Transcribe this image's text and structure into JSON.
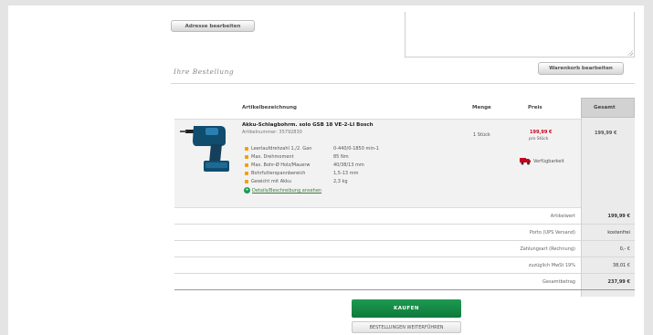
{
  "address": {
    "edit_button": "Adresse bearbeiten"
  },
  "order": {
    "section_title": "Ihre Bestellung",
    "edit_cart_button": "Warenkorb bearbeiten",
    "columns": {
      "name": "Artikelbezeichnung",
      "qty": "Menge",
      "price": "Preis",
      "total": "Gesamt"
    },
    "item": {
      "title": "Akku-Schlagbohrm. solo GSB 18 VE-2-LI Bosch",
      "article_no": "Artikelnummer: 35792830",
      "specs": [
        {
          "label": "Leerlaufdrehzahl 1./2. Gan",
          "value": "0-440/0-1850 min-1"
        },
        {
          "label": "Max. Drehmoment",
          "value": "85 Nm"
        },
        {
          "label": "Max. Bohr-Ø Holz/Mauerw",
          "value": "40/38/13 mm"
        },
        {
          "label": "Bohrfutterspannbereich",
          "value": "1,5-13 mm"
        },
        {
          "label": "Gewicht mit Akku",
          "value": "2,3 kg"
        }
      ],
      "details_link": "Details/Beschreibung ansehen",
      "qty": "1 Stück",
      "price": "199,99 €",
      "price_unit": "pro Stück",
      "availability": "Verfügbarkeit",
      "total": "199,99 €"
    },
    "summary": [
      {
        "label": "Artikelwert",
        "value": "199,99 €"
      },
      {
        "label": "Porto (UPS Versand)",
        "value": "kostenfrei"
      },
      {
        "label": "Zahlungsart (Rechnung)",
        "value": "0,- €"
      },
      {
        "label": "zuzüglich MwSt 19%",
        "value": "38,01 €"
      },
      {
        "label": "Gesamtbetrag",
        "value": "237,99 €"
      }
    ],
    "buy_button": "KAUFEN",
    "continue_link": "BESTELLUNGEN WEITERFÜHREN"
  },
  "colors": {
    "accent_green": "#0d7a3a",
    "price_red": "#c8001e",
    "bullet_orange": "#f0a000"
  },
  "icons": [
    "resize-grip-icon",
    "drill-product-image",
    "truck-icon",
    "info-icon",
    "bullet-icon"
  ]
}
